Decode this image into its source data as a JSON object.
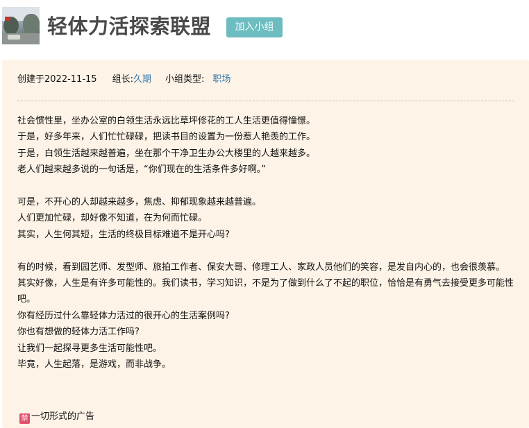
{
  "group": {
    "name": "轻体力活探索联盟",
    "join_label": "加入小组"
  },
  "meta": {
    "created": "创建于2022-11-15",
    "leader_label": "组长:",
    "leader_name": "久期",
    "type_label": "小组类型:",
    "type_value": "职场"
  },
  "description": [
    "社会惯性里，坐办公室的白领生活永远比草坪修花的工人生活更值得憧憬。",
    "于是，好多年来，人们忙忙碌碌，把读书目的设置为一份惹人艳羡的工作。",
    "于是，白领生活越来越普遍，坐在那个干净卫生办公大楼里的人越来越多。",
    "老人们越来越多说的一句话是，“你们现在的生活条件多好啊。”",
    "",
    "可是，不开心的人却越来越多，焦虑、抑郁现象越来越普遍。",
    "人们更加忙碌，却好像不知道，在为何而忙碌。",
    "其实，人生何其短，生活的终极目标难道不是开心吗?",
    "",
    "有的时候，看到园艺师、发型师、旅拍工作者、保安大哥、修理工人、家政人员他们的笑容，是发自内心的，也会很羡慕。",
    "其实好像，人生是有许多可能性的。我们读书，学习知识，不是为了做到什么了不起的职位，恰恰是有勇气去接受更多可能性吧。",
    "你有经历过什么靠轻体力活过的很开心的生活案例吗?",
    "你也有想做的轻体力活工作吗?",
    "让我们一起探寻更多生活可能性吧。",
    "毕竟，人生起落，是游戏，而非战争。"
  ],
  "rules": {
    "ban_icon_text": "禁",
    "ban_text": "一切形式的广告"
  },
  "colors": {
    "join_button": "#6cbcc0",
    "link": "#3377aa",
    "panel_bg": "#fdf3e7",
    "ban_icon": "#e2516b"
  }
}
